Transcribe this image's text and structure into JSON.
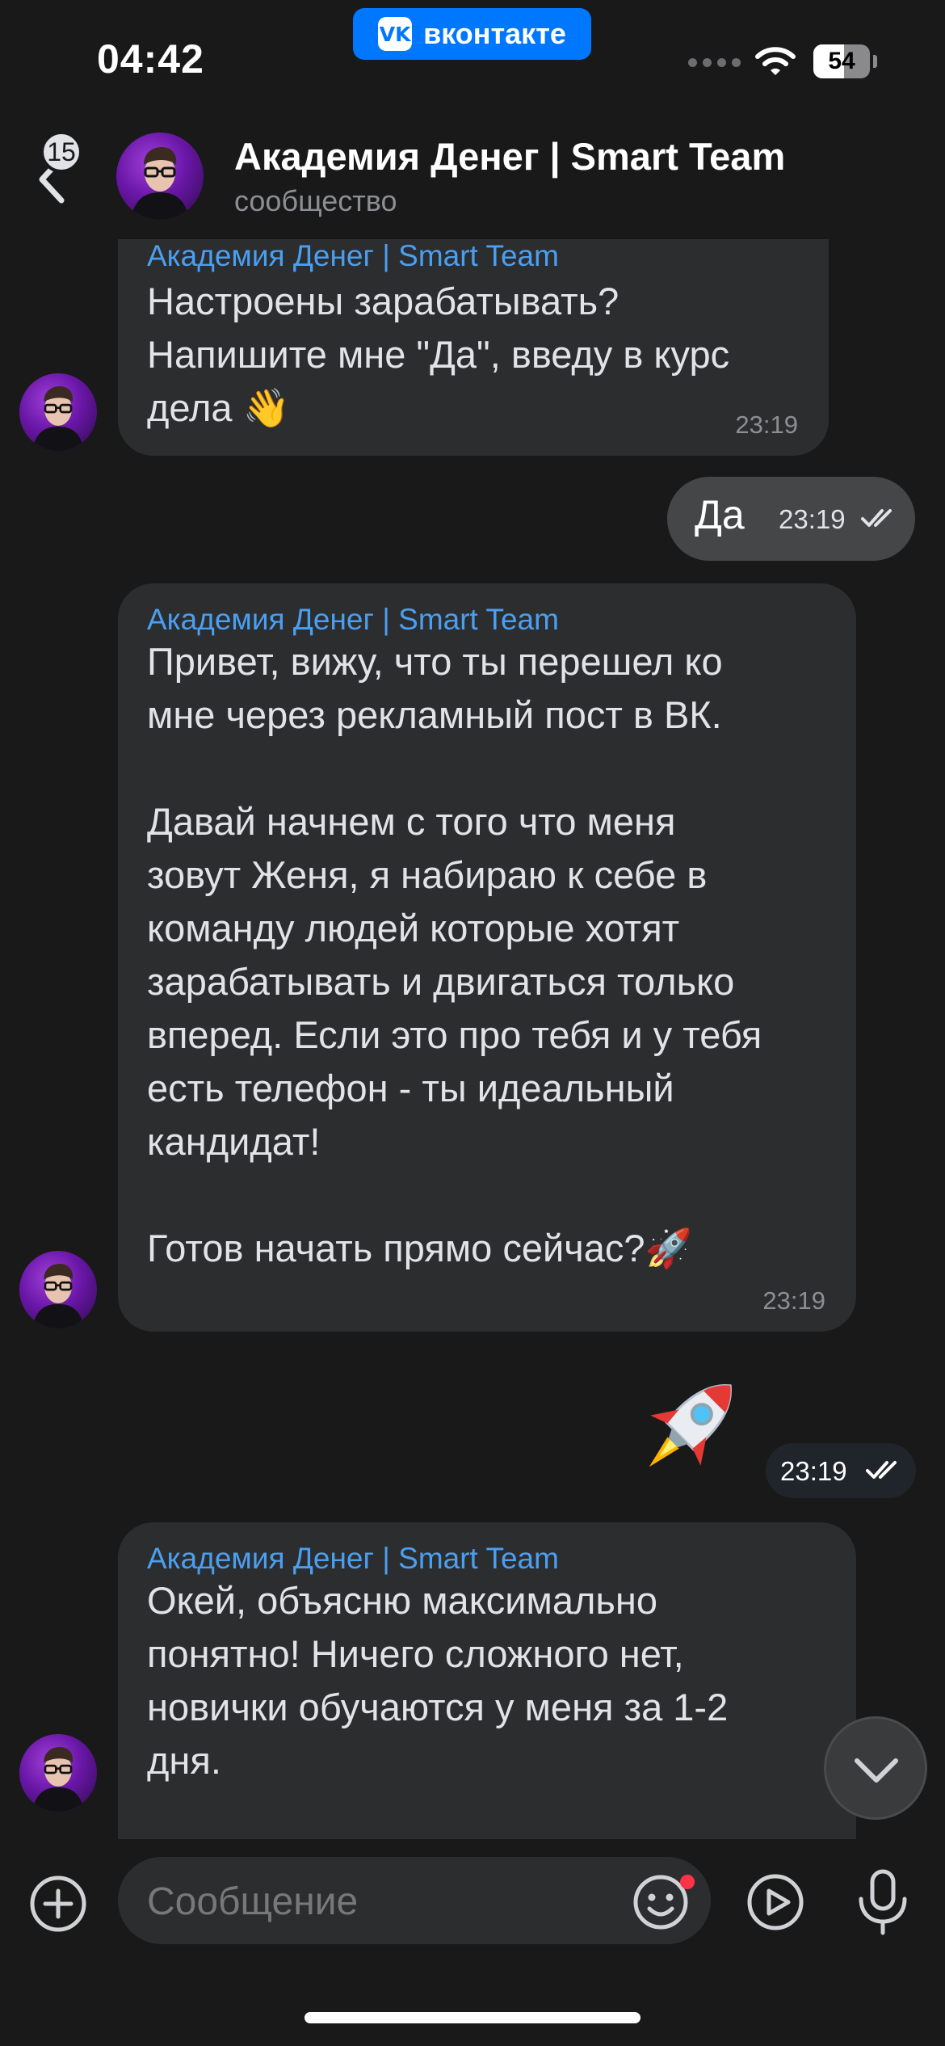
{
  "status_bar": {
    "time": "04:42",
    "app_pill_label": "вконтакте",
    "app_pill_logo": "VK",
    "battery": "54",
    "battery_level": 0.54
  },
  "header": {
    "unread_count": "15",
    "title": "Академия Денег | Smart Team",
    "subtitle": "сообщество"
  },
  "messages": [
    {
      "direction": "in",
      "sender": "Академия Денег | Smart Team",
      "text": "Настроены зарабатывать?\nНапишите мне \"Да\", введу в курс\nдела 👋",
      "time": "23:19"
    },
    {
      "direction": "out",
      "text": "Да",
      "time": "23:19",
      "status": "read"
    },
    {
      "direction": "in",
      "sender": "Академия Денег | Smart Team",
      "text": "Привет, вижу, что ты перешел ко\nмне через рекламный пост в ВК.\n\nДавай начнем с того что меня\nзовут Женя, я набираю к себе в\nкоманду людей которые хотят\nзарабатывать и двигаться только\nвперед. Если это про тебя и у тебя\nесть телефон - ты идеальный\nкандидат!\n\nГотов начать прямо сейчас?🚀",
      "time": "23:19"
    },
    {
      "direction": "out",
      "text": "🚀",
      "time": "23:19",
      "status": "read"
    },
    {
      "direction": "in",
      "sender": "Академия Денег | Smart Team",
      "text": "Окей, объясню максимально\nпонятно! Ничего сложного нет,\nновички обучаются у меня за 1-2\nдня."
    }
  ],
  "composer": {
    "placeholder": "Сообщение"
  },
  "colors": {
    "background": "#19191a",
    "incoming_bubble": "#2c2d2e",
    "outgoing_bubble": "#454647",
    "sender_name": "#4b9ff1",
    "vk_blue": "#0077ff"
  },
  "icons": [
    "back-chevron-icon",
    "wifi-icon",
    "add-circle-icon",
    "sticker-smile-icon",
    "video-message-icon",
    "microphone-icon",
    "chevron-down-icon",
    "double-check-icon"
  ]
}
